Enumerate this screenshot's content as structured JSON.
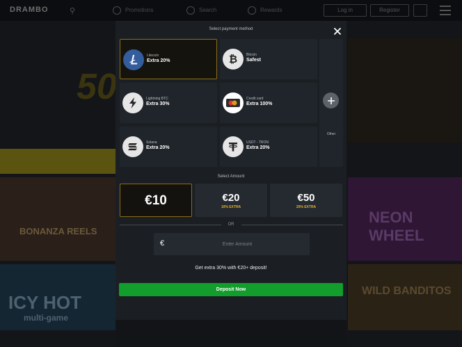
{
  "header": {
    "logo": "DRAMBO",
    "nav": [
      {
        "label": "Promotions"
      },
      {
        "label": "Search"
      },
      {
        "label": "Rewards"
      }
    ],
    "login_label": "Log in",
    "register_label": "Register"
  },
  "background": {
    "promo_text": "50",
    "games": [
      "BONANZA REELS",
      "ICY HOT",
      "multi-game",
      "NEON WHEEL",
      "WILD BANDITOS"
    ]
  },
  "modal": {
    "title": "Select payment method",
    "payment_methods": [
      {
        "name": "Litecoin",
        "bonus": "Extra 20%",
        "icon": "litecoin-icon",
        "color": "#345d9d",
        "selected": true
      },
      {
        "name": "Bitcoin",
        "bonus": "Safest",
        "icon": "bitcoin-icon",
        "color": "#e6e6e6",
        "selected": false
      },
      {
        "name": "Lightning BTC",
        "bonus": "Extra 30%",
        "icon": "lightning-icon",
        "color": "#e6e6e6",
        "selected": false
      },
      {
        "name": "Credit card",
        "bonus": "Extra 100%",
        "icon": "credit-card-icon",
        "color": "#ffffff",
        "selected": false
      },
      {
        "name": "Solana",
        "bonus": "Extra 20%",
        "icon": "solana-icon",
        "color": "#e6e6e6",
        "selected": false
      },
      {
        "name": "USDT - TRON",
        "bonus": "Extra 20%",
        "icon": "tether-icon",
        "color": "#e6e6e6",
        "selected": false
      }
    ],
    "other_label": "Other",
    "select_amount_label": "Select Amount",
    "amounts": [
      {
        "value": "€10",
        "extra": "",
        "selected": true
      },
      {
        "value": "€20",
        "extra": "10% EXTRA",
        "selected": false
      },
      {
        "value": "€50",
        "extra": "20% EXTRA",
        "selected": false
      }
    ],
    "or_label": "OR",
    "currency_symbol": "€",
    "amount_input": {
      "placeholder": "Enter Amount",
      "value": ""
    },
    "extra_text": "Get extra 30% with €20+ deposit!",
    "deposit_label": "Deposit Now"
  },
  "colors": {
    "accent_gold": "#e6b422",
    "selected_border": "#8b6f1a",
    "deposit_green": "#129d2c",
    "modal_bg": "#1b1f24"
  }
}
